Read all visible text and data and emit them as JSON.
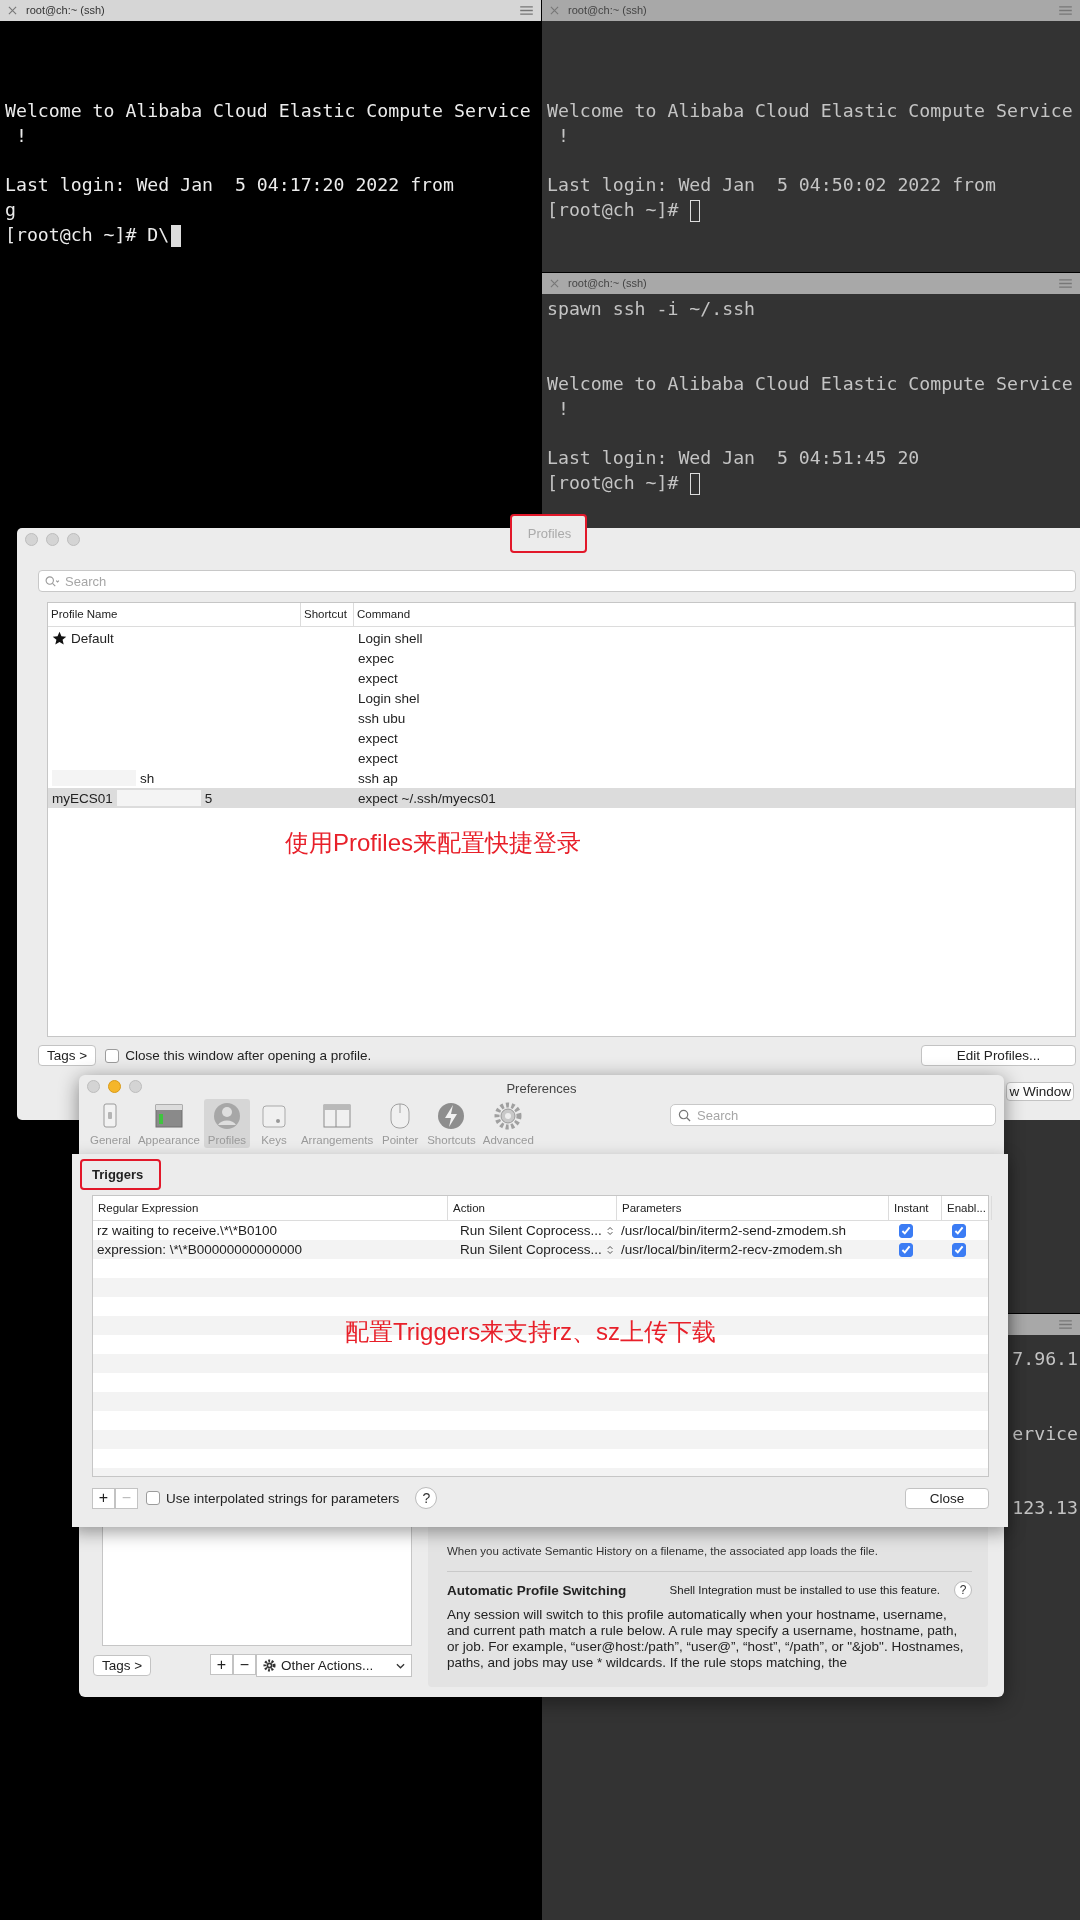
{
  "terminals": [
    {
      "title": "root@ch:~ (ssh)",
      "active": true,
      "text": "\n\n\nWelcome to Alibaba Cloud Elastic Compute Service\n !\n\nLast login: Wed Jan  5 04:17:20 2022 from\ng",
      "prompt": "[root@ch ~]# D\\"
    },
    {
      "title": "root@ch:~ (ssh)",
      "active": false,
      "text": "\n\n\nWelcome to Alibaba Cloud Elastic Compute Service\n !\n\nLast login: Wed Jan  5 04:50:02 2022 from",
      "prompt": "[root@ch ~]#"
    },
    {
      "title": "root@ch:~ (ssh)",
      "active": false,
      "text": "spawn ssh -i ~/.ssh\n\n\nWelcome to Alibaba Cloud Elastic Compute Service\n !\n\nLast login: Wed Jan  5 04:51:45 20\n",
      "prompt": "[root@ch ~]#"
    }
  ],
  "background_terminal": {
    "active": false,
    "text": "7.96.1\n\n\nervice\n\n\n123.13"
  },
  "profiles_window": {
    "title": "Profiles",
    "search": {
      "placeholder": "Search"
    },
    "columns": [
      "Profile Name",
      "Shortcut",
      "Command"
    ],
    "rows": [
      {
        "name": "Default",
        "default": true,
        "command": "Login shell",
        "selected": false
      },
      {
        "default": false,
        "command": "expec",
        "selected": false
      },
      {
        "default": false,
        "command": "expect",
        "selected": false
      },
      {
        "default": false,
        "command": "Login shel",
        "selected": false
      },
      {
        "default": false,
        "command": "ssh ubu",
        "selected": false
      },
      {
        "default": false,
        "command": "expect",
        "selected": false
      },
      {
        "default": false,
        "command": "expect",
        "selected": false
      },
      {
        "name_tail": "sh",
        "default": false,
        "command": "ssh ap",
        "selected": false
      },
      {
        "name": "myECS01",
        "name_tail": "5",
        "default": false,
        "command": "expect ~/.ssh/myecs01",
        "selected": true
      }
    ],
    "annotation": "使用Profiles来配置快捷登录",
    "tags_button": "Tags >",
    "close_after_opening": {
      "label": "Close this window after opening a profile.",
      "checked": false
    },
    "edit_button": "Edit Profiles...",
    "new_window_button": "w Window"
  },
  "preferences_window": {
    "title": "Preferences",
    "toolbar": [
      {
        "label": "General",
        "selected": false
      },
      {
        "label": "Appearance",
        "selected": false
      },
      {
        "label": "Profiles",
        "selected": true
      },
      {
        "label": "Keys",
        "selected": false
      },
      {
        "label": "Arrangements",
        "selected": false
      },
      {
        "label": "Pointer",
        "selected": false
      },
      {
        "label": "Shortcuts",
        "selected": false
      },
      {
        "label": "Advanced",
        "selected": false
      }
    ],
    "search": {
      "placeholder": "Search"
    },
    "tags_button": "Tags >",
    "other_actions": "Other Actions...",
    "semantic_history_note": "When you activate Semantic History on a filename, the associated app loads the file.",
    "auto_switching": {
      "heading": "Automatic Profile Switching",
      "note": "Shell Integration must be installed to use this feature.",
      "help": "?",
      "text": "Any session will switch to this profile automatically when your hostname, username, and current path match a rule below. A rule may specify a username, hostname, path, or job. For example, “user@host:/path”, “user@”, “host”, “/path”, or \"&job\". Hostnames, paths, and jobs may use * wildcards. If the rule stops matching, the"
    }
  },
  "triggers_sheet": {
    "title": "Triggers",
    "columns": [
      "Regular Expression",
      "Action",
      "Parameters",
      "Instant",
      "Enabl..."
    ],
    "rows": [
      {
        "regex": "rz waiting to receive.\\*\\*B0100",
        "action": "Run Silent Coprocess...",
        "parameters": "/usr/local/bin/iterm2-send-zmodem.sh",
        "instant": true,
        "enabled": true
      },
      {
        "regex": "expression: \\*\\*B00000000000000",
        "action": "Run Silent Coprocess...",
        "parameters": "/usr/local/bin/iterm2-recv-zmodem.sh",
        "instant": true,
        "enabled": true
      }
    ],
    "annotation": "配置Triggers来支持rz、sz上传下载",
    "add": "+",
    "remove": "−",
    "interpolated": {
      "label": "Use interpolated strings for parameters",
      "checked": false
    },
    "help": "?",
    "close_button": "Close"
  }
}
